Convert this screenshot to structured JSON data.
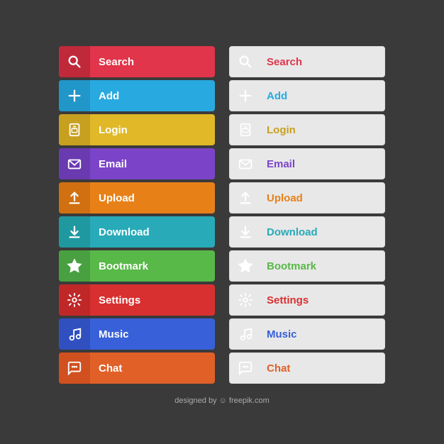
{
  "buttons": [
    {
      "id": "search",
      "label": "Search",
      "colorClass": "btn-search",
      "iconBg": "search-bg",
      "wicon": "wicon-search",
      "lblClass": "lbl-search"
    },
    {
      "id": "add",
      "label": "Add",
      "colorClass": "btn-add",
      "iconBg": "add-bg",
      "wicon": "wicon-add",
      "lblClass": "lbl-add"
    },
    {
      "id": "login",
      "label": "Login",
      "colorClass": "btn-login",
      "iconBg": "login-bg",
      "wicon": "wicon-login",
      "lblClass": "lbl-login"
    },
    {
      "id": "email",
      "label": "Email",
      "colorClass": "btn-email",
      "iconBg": "email-bg",
      "wicon": "wicon-email",
      "lblClass": "lbl-email"
    },
    {
      "id": "upload",
      "label": "Upload",
      "colorClass": "btn-upload",
      "iconBg": "upload-bg",
      "wicon": "wicon-upload",
      "lblClass": "lbl-upload"
    },
    {
      "id": "download",
      "label": "Download",
      "colorClass": "btn-download",
      "iconBg": "download-bg",
      "wicon": "wicon-download",
      "lblClass": "lbl-download"
    },
    {
      "id": "bookmark",
      "label": "Bootmark",
      "colorClass": "btn-bookmark",
      "iconBg": "bookmark-bg",
      "wicon": "wicon-bookmark",
      "lblClass": "lbl-bookmark"
    },
    {
      "id": "settings",
      "label": "Settings",
      "colorClass": "btn-settings",
      "iconBg": "settings-bg",
      "wicon": "wicon-settings",
      "lblClass": "lbl-settings"
    },
    {
      "id": "music",
      "label": "Music",
      "colorClass": "btn-music",
      "iconBg": "music-bg",
      "wicon": "wicon-music",
      "lblClass": "lbl-music"
    },
    {
      "id": "chat",
      "label": "Chat",
      "colorClass": "btn-chat",
      "iconBg": "chat-bg",
      "wicon": "wicon-chat",
      "lblClass": "lbl-chat"
    }
  ],
  "footer": "designed by  freepik.com"
}
